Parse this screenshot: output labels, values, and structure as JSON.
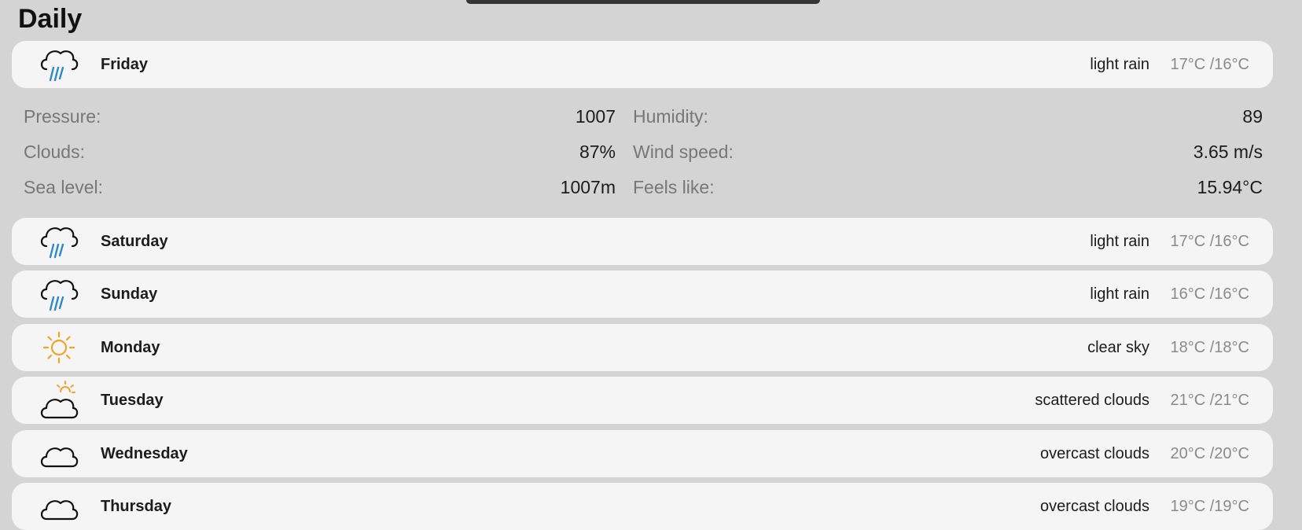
{
  "header": {
    "title": "Daily"
  },
  "days": [
    {
      "name": "Friday",
      "description": "light rain",
      "temp": "17°C /16°C",
      "icon": "rain-cloud-icon"
    },
    {
      "name": "Saturday",
      "description": "light rain",
      "temp": "17°C /16°C",
      "icon": "rain-cloud-icon"
    },
    {
      "name": "Sunday",
      "description": "light rain",
      "temp": "16°C /16°C",
      "icon": "rain-cloud-icon"
    },
    {
      "name": "Monday",
      "description": "clear sky",
      "temp": "18°C /18°C",
      "icon": "sun-icon"
    },
    {
      "name": "Tuesday",
      "description": "scattered clouds",
      "temp": "21°C /21°C",
      "icon": "sun-cloud-icon"
    },
    {
      "name": "Wednesday",
      "description": "overcast clouds",
      "temp": "20°C /20°C",
      "icon": "cloud-icon"
    },
    {
      "name": "Thursday",
      "description": "overcast clouds",
      "temp": "19°C /19°C",
      "icon": "cloud-icon"
    }
  ],
  "details": {
    "pressure": {
      "label": "Pressure:",
      "value": "1007"
    },
    "clouds": {
      "label": "Clouds:",
      "value": "87%"
    },
    "sea_level": {
      "label": "Sea level:",
      "value": "1007m"
    },
    "humidity": {
      "label": "Humidity:",
      "value": "89"
    },
    "wind_speed": {
      "label": "Wind speed:",
      "value": "3.65 m/s"
    },
    "feels_like": {
      "label": "Feels like:",
      "value": "15.94°C"
    }
  },
  "colors": {
    "background": "#d4d4d4",
    "card": "#f5f5f5",
    "rain": "#2f88c8",
    "sun": "#f0a52a",
    "muted_text": "#8a8a8a"
  }
}
